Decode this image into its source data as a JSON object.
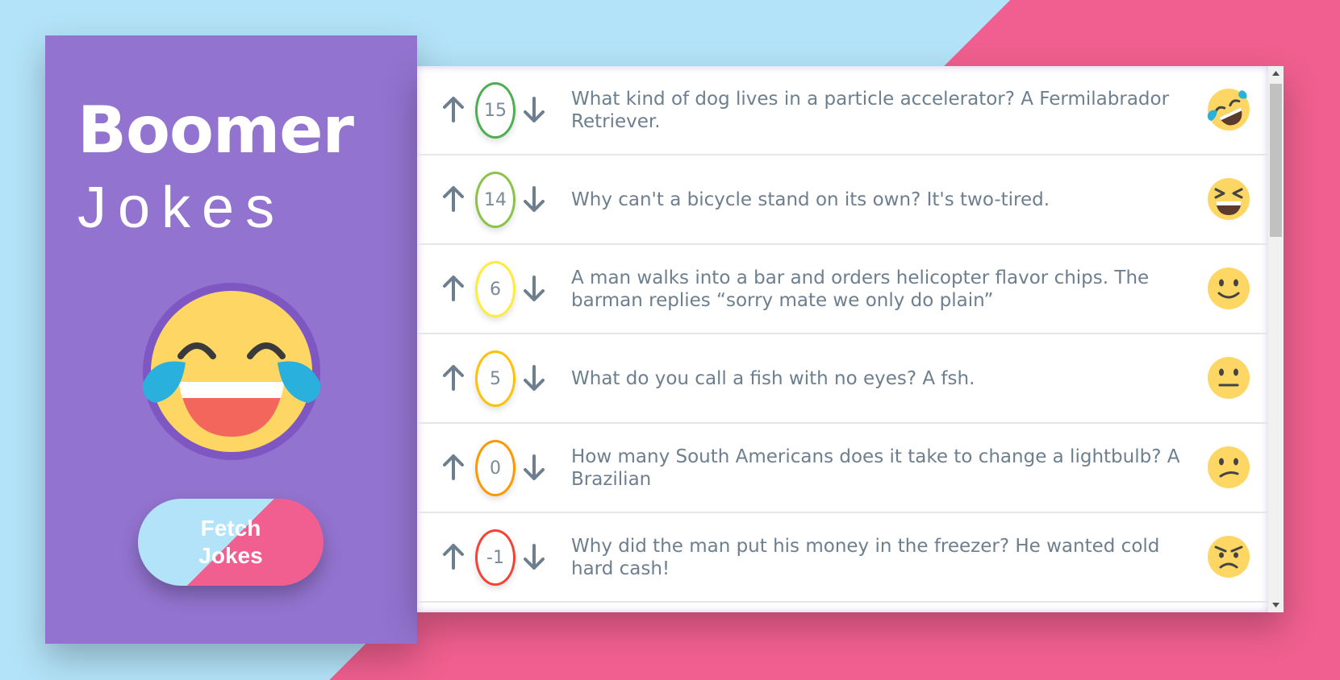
{
  "app": {
    "title_bold": "Boomer",
    "title_light": "Jokes",
    "fetch_button_label": "Fetch Jokes",
    "hero_icon": "face-with-tears-of-joy-icon"
  },
  "colors": {
    "background_left": "#b3e3f8",
    "background_right": "#f05f8f",
    "sidebar": "#9273cf",
    "text": "#6d7f8f"
  },
  "jokes": [
    {
      "votes": "15",
      "text": "What kind of dog lives in a particle accelerator? A Fermilabrador Retriever.",
      "border_color": "#4caf50",
      "emoji": "rolling-on-floor-laughing-icon"
    },
    {
      "votes": "14",
      "text": "Why can't a bicycle stand on its own? It's two-tired.",
      "border_color": "#8bc34a",
      "emoji": "grinning-squinting-face-icon"
    },
    {
      "votes": "6",
      "text": "A man walks into a bar and orders helicopter flavor chips. The barman replies “sorry mate we only do plain”",
      "border_color": "#ffeb3b",
      "emoji": "slightly-smiling-face-icon"
    },
    {
      "votes": "5",
      "text": "What do you call a fish with no eyes? A fsh.",
      "border_color": "#ffc107",
      "emoji": "neutral-face-icon"
    },
    {
      "votes": "0",
      "text": "How many South Americans does it take to change a lightbulb? A Brazilian",
      "border_color": "#ff9800",
      "emoji": "confused-face-icon"
    },
    {
      "votes": "-1",
      "text": "Why did the man put his money in the freezer? He wanted cold hard cash!",
      "border_color": "#f44336",
      "emoji": "angry-face-icon"
    }
  ]
}
